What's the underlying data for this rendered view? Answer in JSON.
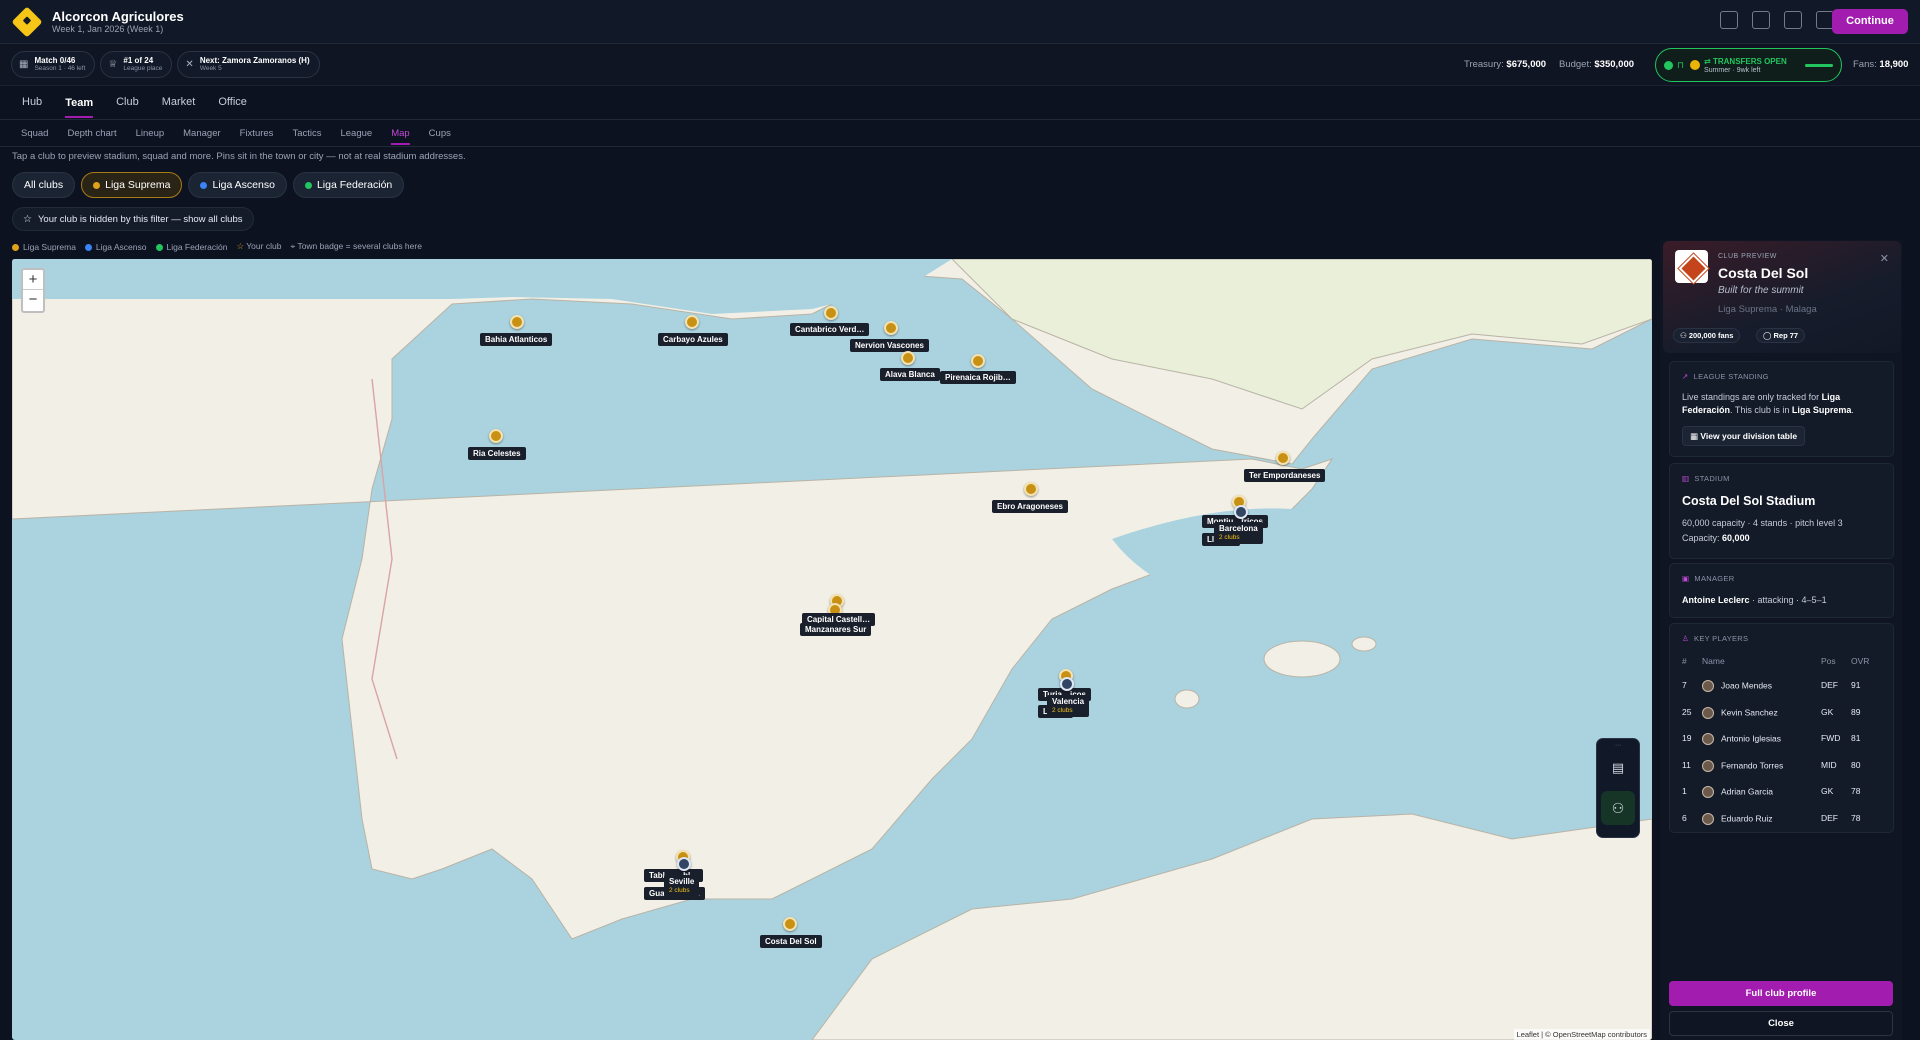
{
  "app": {
    "title": "Alcorcon Agriculores",
    "subtitle": "Week 1, Jan 2026 (Week 1)",
    "continue_label": "Continue"
  },
  "status": {
    "match": {
      "title": "Match 0/46",
      "sub": "Season 1 · 46 left"
    },
    "place": {
      "title": "#1 of 24",
      "sub": "League place"
    },
    "next": {
      "title": "Next: Zamora Zamoranos (H)",
      "sub": "Week 5"
    },
    "treasury_label": "Treasury:",
    "treasury": "$675,000",
    "budget_label": "Budget:",
    "budget": "$350,000",
    "transfers": "TRANSFERS OPEN",
    "transfers_sub": "Summer · 9wk left",
    "fans_label": "Fans:",
    "fans": "18,900"
  },
  "nav": [
    "Hub",
    "Team",
    "Club",
    "Market",
    "Office"
  ],
  "subnav": [
    "Squad",
    "Depth chart",
    "Lineup",
    "Manager",
    "Fixtures",
    "Tactics",
    "League",
    "Map",
    "Cups"
  ],
  "hint": "Tap a club to preview stadium, squad and more. Pins sit in the town or city — not at real stadium addresses.",
  "filters": [
    {
      "label": "All clubs"
    },
    {
      "label": "Liga Suprema",
      "color": "#e0a21a"
    },
    {
      "label": "Liga Ascenso",
      "color": "#3b82f6"
    },
    {
      "label": "Liga Federación",
      "color": "#22c55e"
    }
  ],
  "hidden_note": "Your club is hidden by this filter — show all clubs",
  "legend": [
    "Liga Suprema",
    "Liga Ascenso",
    "Liga Federación",
    "Your club",
    "Town badge = several clubs here"
  ],
  "map": {
    "labels": {
      "bahia": "Bahia Atlanticos",
      "carbayo": "Carbayo Azules",
      "cantabrico": "Cantabrico Verd…",
      "nervion": "Nervion Vascones",
      "alava": "Alava Blanca",
      "pirenaica": "Pirenaica Rojib…",
      "ria": "Ria Celestes",
      "ter": "Ter Empordaneses",
      "ebro": "Ebro Aragoneses",
      "montju": "Montju…tricos",
      "barcelona": "Barcelona",
      "barcelona_sub": "2 clubs",
      "lli": "Lli… …",
      "capital": "Capital Castell…",
      "manzanares": "Manzanares Sur",
      "turia": "Turia…icos",
      "valencia": "Valencia",
      "valencia_sub": "2 clubs",
      "lev": "L… …l",
      "tabl": "Tabl… …bl…",
      "seville": "Seville",
      "seville_sub": "2 clubs",
      "gua": "Gua… …na…",
      "costa": "Costa Del Sol"
    },
    "attribution": "Leaflet | © OpenStreetMap contributors"
  },
  "preview": {
    "kicker": "CLUB PREVIEW",
    "name": "Costa Del Sol",
    "motto": "Built for the summit",
    "league_city": "Liga Suprema · Malaga",
    "fans": "200,000 fans",
    "rep": "Rep 77",
    "standing_title": "LEAGUE STANDING",
    "standing_text1": "Live standings are only tracked for ",
    "standing_bold1": "Liga Federación",
    "standing_text2": ". This club is in ",
    "standing_bold2": "Liga Suprema",
    "standing_text3": ".",
    "standing_btn": "View your division table",
    "stadium_title": "STADIUM",
    "stadium_name": "Costa Del Sol Stadium",
    "stadium_detail": "60,000 capacity · 4 stands · pitch level 3",
    "capacity_label": "Capacity:",
    "capacity": "60,000",
    "manager_title": "MANAGER",
    "manager_name": "Antoine Leclerc",
    "manager_detail": " · attacking · 4–5–1",
    "players_title": "KEY PLAYERS",
    "players_head": [
      "#",
      "Name",
      "Pos",
      "OVR"
    ],
    "players": [
      {
        "num": "7",
        "name": "Joao Mendes",
        "pos": "DEF",
        "ovr": "91"
      },
      {
        "num": "25",
        "name": "Kevin Sanchez",
        "pos": "GK",
        "ovr": "89"
      },
      {
        "num": "19",
        "name": "Antonio Iglesias",
        "pos": "FWD",
        "ovr": "81"
      },
      {
        "num": "11",
        "name": "Fernando Torres",
        "pos": "MID",
        "ovr": "80"
      },
      {
        "num": "1",
        "name": "Adrian Garcia",
        "pos": "GK",
        "ovr": "78"
      },
      {
        "num": "6",
        "name": "Eduardo Ruiz",
        "pos": "DEF",
        "ovr": "78"
      }
    ],
    "full_profile": "Full club profile",
    "close": "Close"
  }
}
